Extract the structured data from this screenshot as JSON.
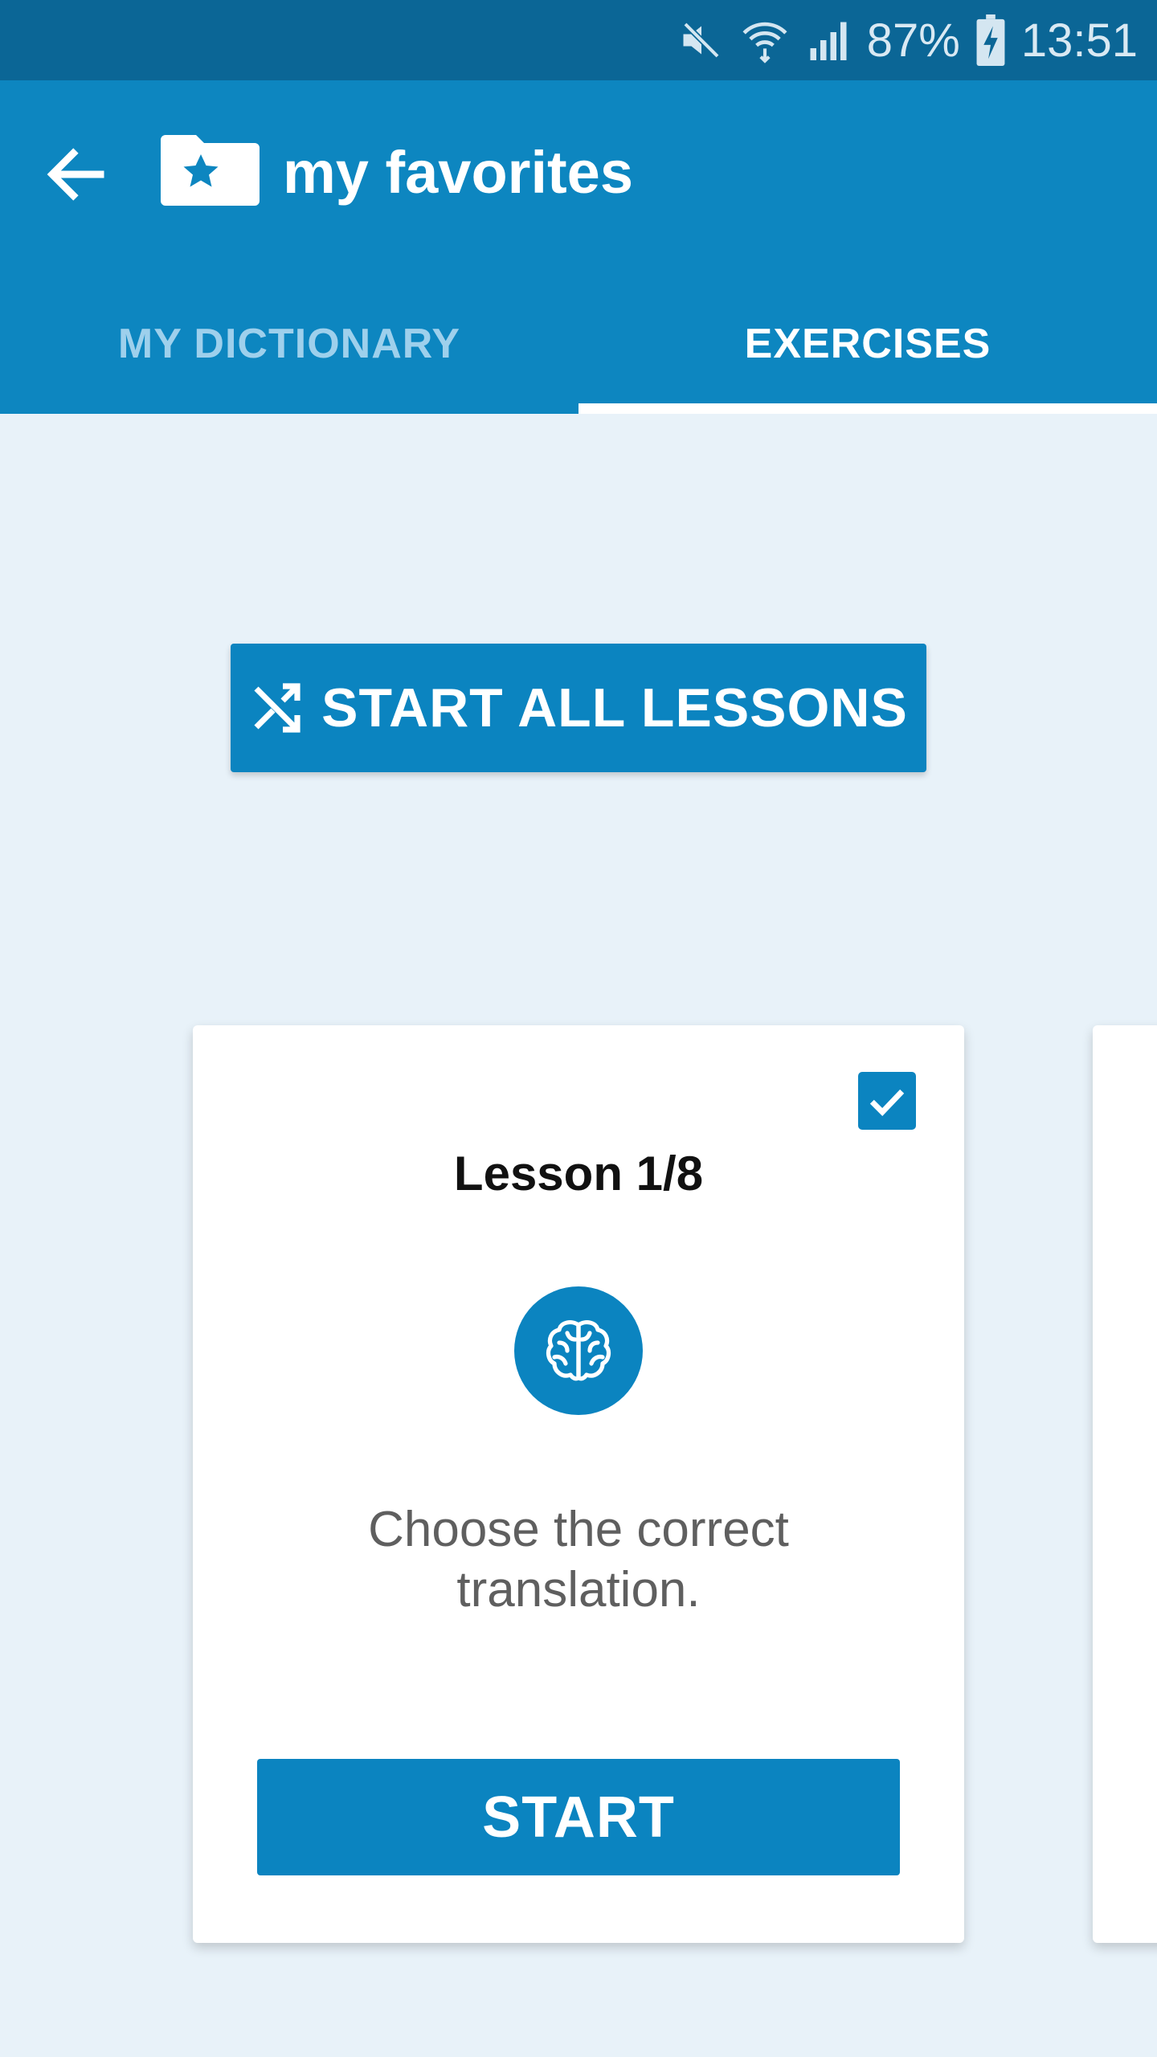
{
  "status_bar": {
    "battery_percent": "87%",
    "time": "13:51",
    "icons": [
      "mute-icon",
      "wifi-icon",
      "signal-icon",
      "battery-charging-icon"
    ]
  },
  "app_bar": {
    "title": "my favorites",
    "back_icon": "arrow-left-icon",
    "title_icon": "folder-star-icon"
  },
  "tabs": [
    {
      "label": "MY DICTIONARY",
      "selected": false
    },
    {
      "label": "EXERCISES",
      "selected": true
    }
  ],
  "main": {
    "start_all_label": "START ALL LESSONS",
    "start_all_icon": "shuffle-icon"
  },
  "lesson_card": {
    "title": "Lesson 1/8",
    "checked": true,
    "icon": "brain-icon",
    "description": "Choose the correct translation.",
    "start_label": "START"
  },
  "colors": {
    "status_bar": "#0b6696",
    "app_bar": "#0d86c0",
    "accent": "#0b84c0",
    "background": "#e8f2f9"
  }
}
